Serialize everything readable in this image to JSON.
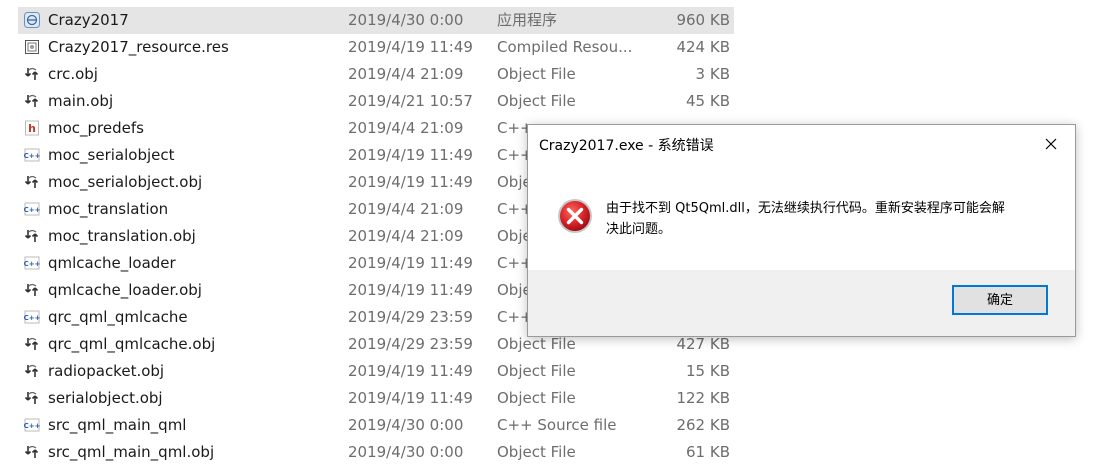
{
  "files": [
    {
      "icon": "app-icon",
      "name": "Crazy2017",
      "date": "2019/4/30 0:00",
      "type": "应用程序",
      "size": "960 KB",
      "selected": true
    },
    {
      "icon": "resource-icon",
      "name": "Crazy2017_resource.res",
      "date": "2019/4/19 11:49",
      "type": "Compiled Resou...",
      "size": "424 KB"
    },
    {
      "icon": "obj-icon",
      "name": "crc.obj",
      "date": "2019/4/4 21:09",
      "type": "Object File",
      "size": "3 KB"
    },
    {
      "icon": "obj-icon",
      "name": "main.obj",
      "date": "2019/4/21 10:57",
      "type": "Object File",
      "size": "45 KB"
    },
    {
      "icon": "header-icon",
      "name": "moc_predefs",
      "date": "2019/4/4 21:09",
      "type": "C++",
      "size": ""
    },
    {
      "icon": "cpp-icon",
      "name": "moc_serialobject",
      "date": "2019/4/19 11:49",
      "type": "C++",
      "size": ""
    },
    {
      "icon": "obj-icon",
      "name": "moc_serialobject.obj",
      "date": "2019/4/19 11:49",
      "type": "Obje",
      "size": ""
    },
    {
      "icon": "cpp-icon",
      "name": "moc_translation",
      "date": "2019/4/4 21:09",
      "type": "C++",
      "size": ""
    },
    {
      "icon": "obj-icon",
      "name": "moc_translation.obj",
      "date": "2019/4/4 21:09",
      "type": "Obje",
      "size": ""
    },
    {
      "icon": "cpp-icon",
      "name": "qmlcache_loader",
      "date": "2019/4/19 11:49",
      "type": "C++",
      "size": ""
    },
    {
      "icon": "obj-icon",
      "name": "qmlcache_loader.obj",
      "date": "2019/4/19 11:49",
      "type": "Obje",
      "size": ""
    },
    {
      "icon": "cpp-icon",
      "name": "qrc_qml_qmlcache",
      "date": "2019/4/29 23:59",
      "type": "C++",
      "size": ""
    },
    {
      "icon": "obj-icon",
      "name": "qrc_qml_qmlcache.obj",
      "date": "2019/4/29 23:59",
      "type": "Object File",
      "size": "427 KB"
    },
    {
      "icon": "obj-icon",
      "name": "radiopacket.obj",
      "date": "2019/4/19 11:49",
      "type": "Object File",
      "size": "15 KB"
    },
    {
      "icon": "obj-icon",
      "name": "serialobject.obj",
      "date": "2019/4/19 11:49",
      "type": "Object File",
      "size": "122 KB"
    },
    {
      "icon": "cpp-icon",
      "name": "src_qml_main_qml",
      "date": "2019/4/30 0:00",
      "type": "C++ Source file",
      "size": "262 KB"
    },
    {
      "icon": "obj-icon",
      "name": "src_qml_main_qml.obj",
      "date": "2019/4/30 0:00",
      "type": "Object File",
      "size": "61 KB"
    }
  ],
  "dialog": {
    "title": "Crazy2017.exe - 系统错误",
    "message_line1": "由于找不到 Qt5Qml.dll，无法继续执行代码。重新安装程序可能会解",
    "message_line2": "决此问题。",
    "ok_label": "确定",
    "icon": "error-icon",
    "close_icon": "close-icon"
  },
  "colors": {
    "selected_row": "#e5e5e5",
    "error_red": "#d9262b",
    "button_focus": "#0078d7"
  }
}
